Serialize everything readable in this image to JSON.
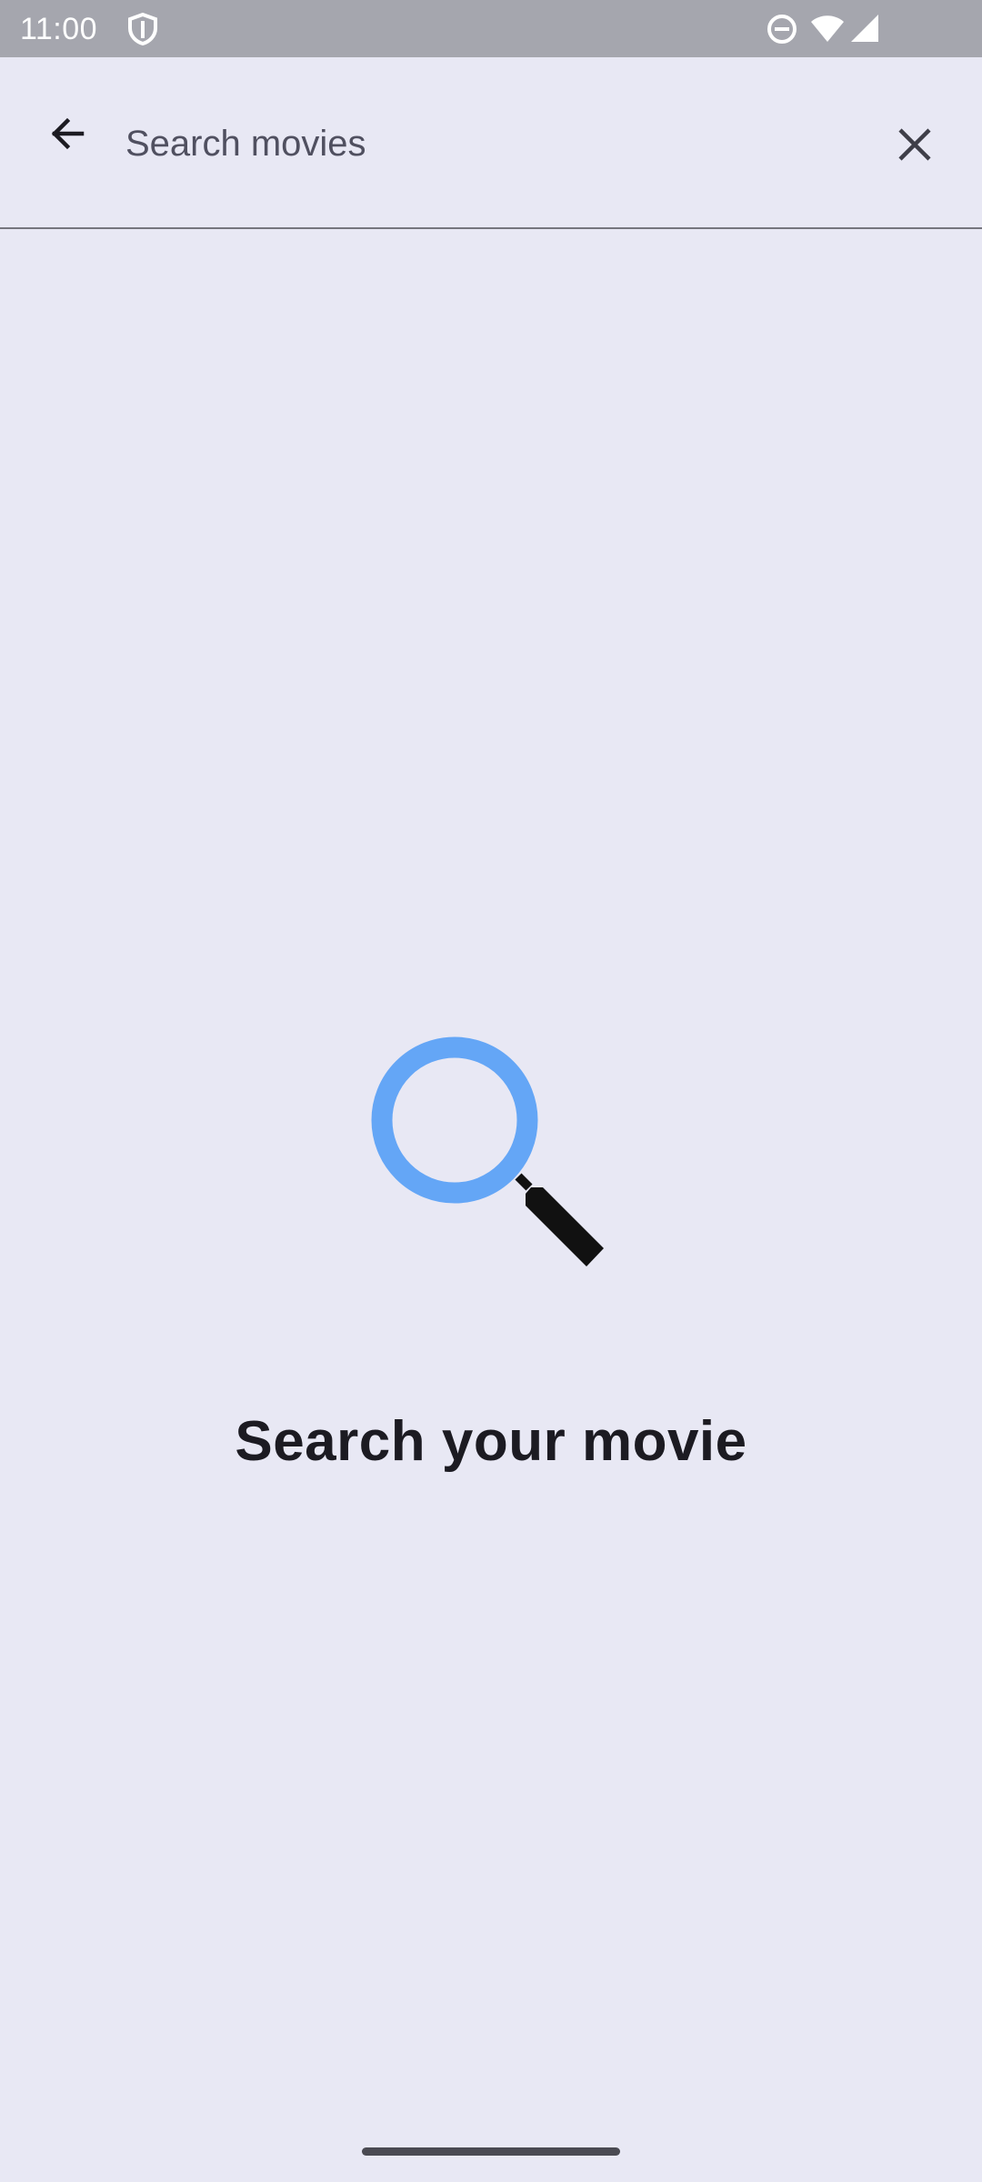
{
  "status_bar": {
    "time": "11:00",
    "icons": [
      "shield-icon",
      "do-not-disturb-icon",
      "wifi-icon",
      "signal-icon"
    ]
  },
  "search": {
    "value": "",
    "placeholder": "Search movies",
    "back_icon": "arrow-back-icon",
    "clear_icon": "close-icon"
  },
  "empty_state": {
    "illustration": "magnifier-icon",
    "title": "Search your movie"
  },
  "colors": {
    "background": "#e8e8f4",
    "status_bar": "#a5a6ae",
    "magnifier_ring": "#64a6f6",
    "text_primary": "#1c1b22"
  }
}
